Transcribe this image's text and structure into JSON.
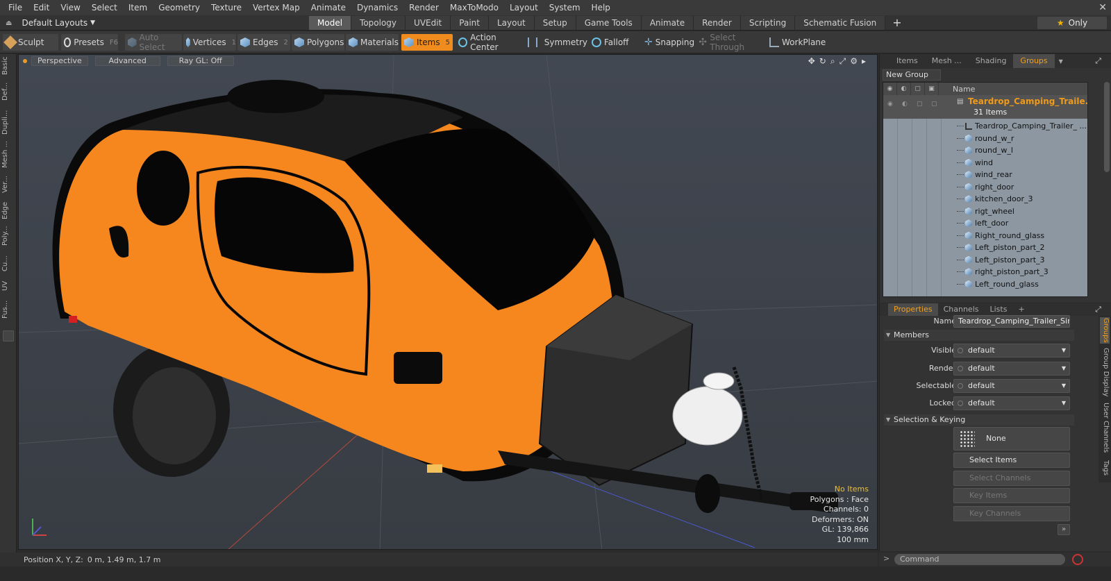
{
  "menubar": {
    "items": [
      "File",
      "Edit",
      "View",
      "Select",
      "Item",
      "Geometry",
      "Texture",
      "Vertex Map",
      "Animate",
      "Dynamics",
      "Render",
      "MaxToModo",
      "Layout",
      "System",
      "Help"
    ]
  },
  "layouts": {
    "dropdown": "Default Layouts",
    "tabs": [
      "Model",
      "Topology",
      "UVEdit",
      "Paint",
      "Layout",
      "Setup",
      "Game Tools",
      "Animate",
      "Render",
      "Scripting",
      "Schematic Fusion"
    ],
    "active_tab": "Model",
    "only_label": "Only"
  },
  "toolbar": {
    "sculpt": "Sculpt",
    "presets": "Presets",
    "presets_key": "F6",
    "auto_select": "Auto Select",
    "vertices": "Vertices",
    "vertices_key": "1",
    "edges": "Edges",
    "edges_key": "2",
    "polygons": "Polygons",
    "materials": "Materials",
    "items": "Items",
    "items_key": "5",
    "action_center": "Action Center",
    "symmetry": "Symmetry",
    "falloff": "Falloff",
    "snapping": "Snapping",
    "select_through": "Select Through",
    "workplane": "WorkPlane"
  },
  "left_palette": [
    "Basic",
    "Def...",
    "Dupli...",
    "Mesh ...",
    "Ver...",
    "Edge",
    "Poly...",
    "Cu...",
    "UV",
    "Fus..."
  ],
  "viewport": {
    "view": "Perspective",
    "shading": "Advanced",
    "raygl": "Ray GL: Off",
    "info": {
      "selection": "No Items",
      "polygons": "Polygons : Face",
      "channels": "Channels: 0",
      "deformers": "Deformers: ON",
      "gl": "GL: 139,866",
      "scale": "100 mm"
    },
    "colors": {
      "body": "#f5871e",
      "shell_dark": "#0a0a0a",
      "ground": "#3c4148"
    }
  },
  "statusbar": {
    "label": "Position X, Y, Z:",
    "value": "0 m, 1.49 m, 1.7 m"
  },
  "groups_panel": {
    "tabs": [
      "Items",
      "Mesh ...",
      "Shading",
      "Groups"
    ],
    "active_tab": "Groups",
    "new_group": "New Group",
    "column_name": "Name",
    "group": {
      "name": "Teardrop_Camping_Traile...",
      "count": "31 Items"
    },
    "items": [
      {
        "name": "Teardrop_Camping_Trailer_ ...",
        "type": "locator"
      },
      {
        "name": "round_w_r",
        "type": "mesh"
      },
      {
        "name": "round_w_l",
        "type": "mesh"
      },
      {
        "name": "wind",
        "type": "mesh"
      },
      {
        "name": "wind_rear",
        "type": "mesh"
      },
      {
        "name": "right_door",
        "type": "mesh"
      },
      {
        "name": "kitchen_door_3",
        "type": "mesh"
      },
      {
        "name": "rigt_wheel",
        "type": "mesh"
      },
      {
        "name": "left_door",
        "type": "mesh"
      },
      {
        "name": "Right_round_glass",
        "type": "mesh"
      },
      {
        "name": "Left_piston_part_2",
        "type": "mesh"
      },
      {
        "name": "Left_piston_part_3",
        "type": "mesh"
      },
      {
        "name": "right_piston_part_3",
        "type": "mesh"
      },
      {
        "name": "Left_round_glass",
        "type": "mesh"
      }
    ]
  },
  "properties_panel": {
    "tabs": [
      "Properties",
      "Channels",
      "Lists"
    ],
    "active_tab": "Properties",
    "name_label": "Name",
    "name_value": "Teardrop_Camping_Trailer_Simple",
    "members_section": "Members",
    "visible_label": "Visible",
    "visible_value": "default",
    "render_label": "Render",
    "render_value": "default",
    "selectable_label": "Selectable",
    "selectable_value": "default",
    "locked_label": "Locked",
    "locked_value": "default",
    "selection_section": "Selection & Keying",
    "none_btn": "None",
    "select_items": "Select Items",
    "select_channels": "Select Channels",
    "key_items": "Key Items",
    "key_channels": "Key Channels",
    "side_tabs": [
      "Groups",
      "Group Display",
      "User Channels",
      "Tags"
    ]
  },
  "command": {
    "placeholder": "Command"
  }
}
